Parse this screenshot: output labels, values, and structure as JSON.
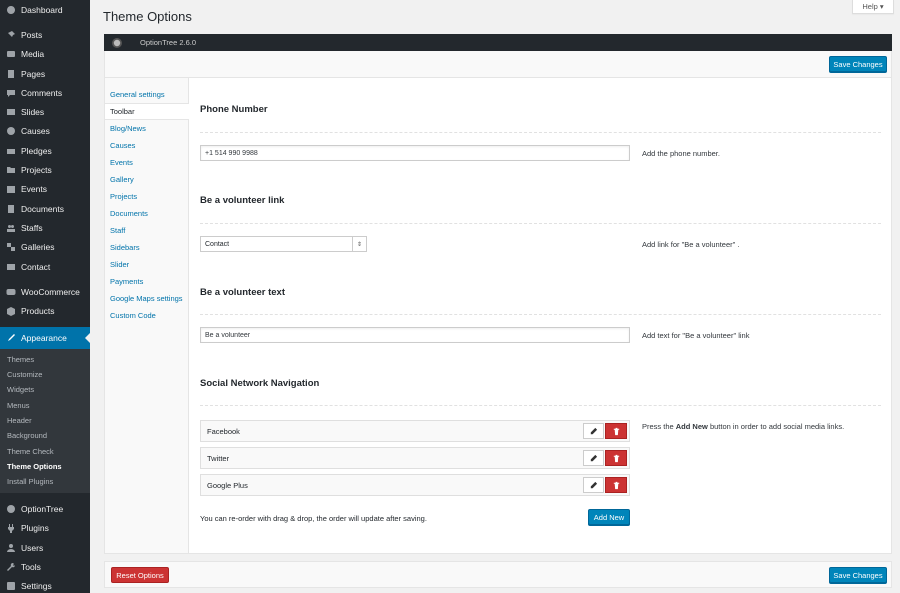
{
  "sidebar": {
    "top": [
      {
        "label": "Dashboard",
        "icon": "dashboard-icon"
      },
      {
        "sep": true
      },
      {
        "label": "Posts",
        "icon": "pin-icon"
      },
      {
        "label": "Media",
        "icon": "media-icon"
      },
      {
        "label": "Pages",
        "icon": "page-icon"
      },
      {
        "label": "Comments",
        "icon": "comment-icon"
      },
      {
        "label": "Slides",
        "icon": "slides-icon"
      },
      {
        "label": "Causes",
        "icon": "causes-icon"
      },
      {
        "label": "Pledges",
        "icon": "pledges-icon"
      },
      {
        "label": "Projects",
        "icon": "projects-icon"
      },
      {
        "label": "Events",
        "icon": "calendar-icon"
      },
      {
        "label": "Documents",
        "icon": "documents-icon"
      },
      {
        "label": "Staffs",
        "icon": "staff-icon"
      },
      {
        "label": "Galleries",
        "icon": "gallery-icon"
      },
      {
        "label": "Contact",
        "icon": "mail-icon"
      },
      {
        "sep": true
      },
      {
        "label": "WooCommerce",
        "icon": "woocommerce-icon"
      },
      {
        "label": "Products",
        "icon": "products-icon"
      },
      {
        "sep": true
      }
    ],
    "current": {
      "label": "Appearance",
      "icon": "appearance-icon"
    },
    "submenu": [
      "Themes",
      "Customize",
      "Widgets",
      "Menus",
      "Header",
      "Background",
      "Theme Check",
      "Theme Options",
      "Install Plugins"
    ],
    "submenu_current": "Theme Options",
    "bottom": [
      {
        "sep": true
      },
      {
        "label": "OptionTree",
        "icon": "optiontree-icon"
      },
      {
        "label": "Plugins",
        "icon": "plugin-icon"
      },
      {
        "label": "Users",
        "icon": "users-icon"
      },
      {
        "label": "Tools",
        "icon": "tools-icon"
      },
      {
        "label": "Settings",
        "icon": "settings-icon"
      }
    ]
  },
  "header": {
    "title": "Theme Options",
    "help": "Help ▾"
  },
  "optiontree": {
    "version": "OptionTree 2.6.0",
    "save_label": "Save Changes",
    "reset_label": "Reset Options",
    "tabs": [
      "General settings",
      "Toolbar",
      "Blog/News",
      "Causes",
      "Events",
      "Gallery",
      "Projects",
      "Documents",
      "Staff",
      "Sidebars",
      "Slider",
      "Payments",
      "Google Maps settings",
      "Custom Code"
    ],
    "active_tab": "Toolbar"
  },
  "fields": {
    "phone": {
      "title": "Phone Number",
      "value": "+1 514 990 9988",
      "desc": "Add the phone number."
    },
    "volunteer_link": {
      "title": "Be a volunteer link",
      "value": "Contact",
      "desc": "Add link for \"Be a volunteer\" ."
    },
    "volunteer_text": {
      "title": "Be a volunteer text",
      "value": "Be a volunteer",
      "desc": "Add text for \"Be a volunteer\" link"
    },
    "social": {
      "title": "Social Network Navigation",
      "items": [
        "Facebook",
        "Twitter",
        "Google Plus"
      ],
      "desc_pre": "Press the ",
      "desc_bold": "Add New",
      "desc_post": " button in order to add social media links.",
      "note": "You can re-order with drag & drop, the order will update after saving.",
      "add_new": "Add New"
    }
  },
  "colors": {
    "primary": "#0085ba",
    "danger": "#cc3333",
    "sidebar": "#23282d",
    "accent": "#0073aa"
  }
}
